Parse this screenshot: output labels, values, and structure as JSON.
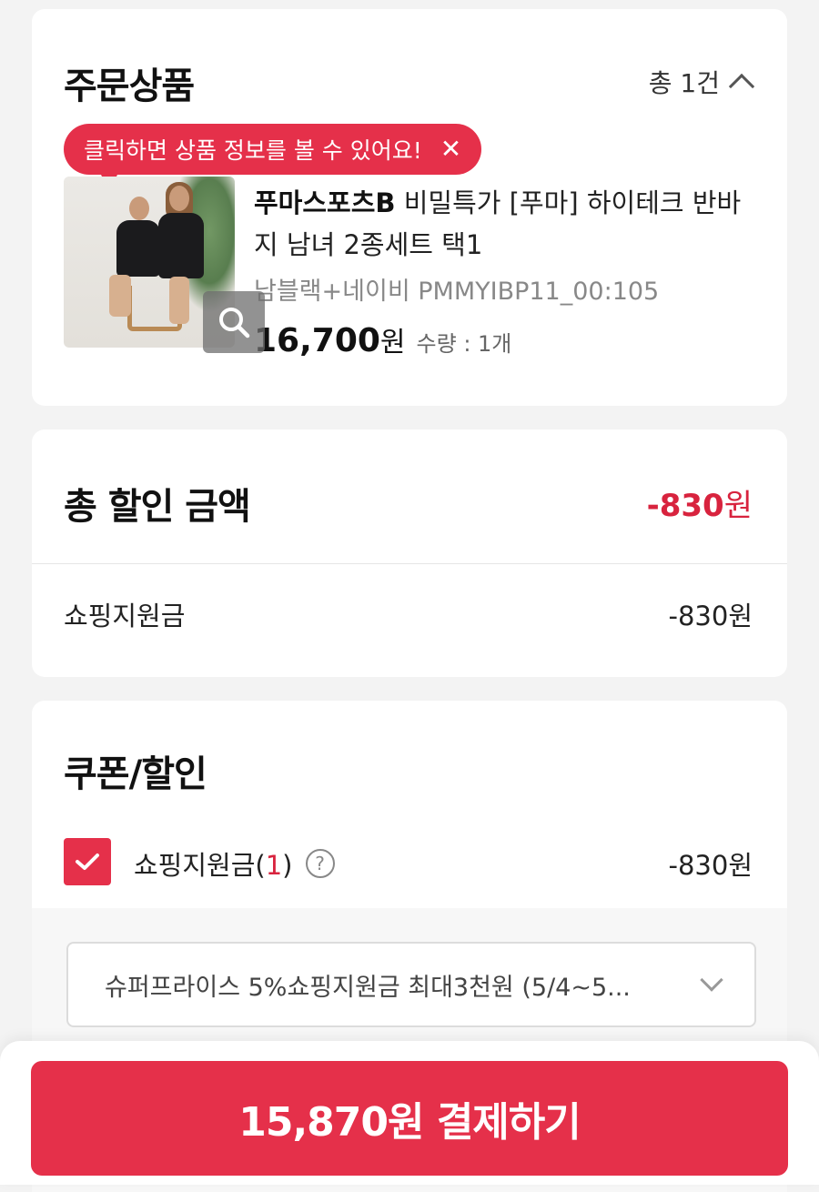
{
  "order": {
    "title": "주문상품",
    "count_text": "총 1건",
    "tooltip": "클릭하면 상품 정보를 볼 수 있어요!",
    "tooltip_close": "✕",
    "product": {
      "brand": "푸마스포츠B",
      "name": " 비밀특가 [푸마] 하이테크 반바지 남녀 2종세트 택1",
      "option": "남블랙+네이비 PMMYIBP11_00:105",
      "price": "16,700",
      "price_unit": "원",
      "quantity": "수량 : 1개"
    }
  },
  "discount": {
    "title": "총 할인 금액",
    "total": "-830",
    "total_unit": "원",
    "row_label": "쇼핑지원금",
    "row_value": "-830원"
  },
  "coupon": {
    "title": "쿠폰/할인",
    "item_label": "쇼핑지원금(",
    "item_count": "1",
    "item_label_end": ")",
    "help": "?",
    "item_value": "-830원",
    "checked": true,
    "select_text": "슈퍼프라이스 5%쇼핑지원금 최대3천원 (5/4~5..."
  },
  "payment": {
    "button_label": "15,870원 결제하기"
  },
  "colors": {
    "accent": "#e5304a",
    "discount_red": "#d8233e",
    "background": "#f3f3f3"
  }
}
